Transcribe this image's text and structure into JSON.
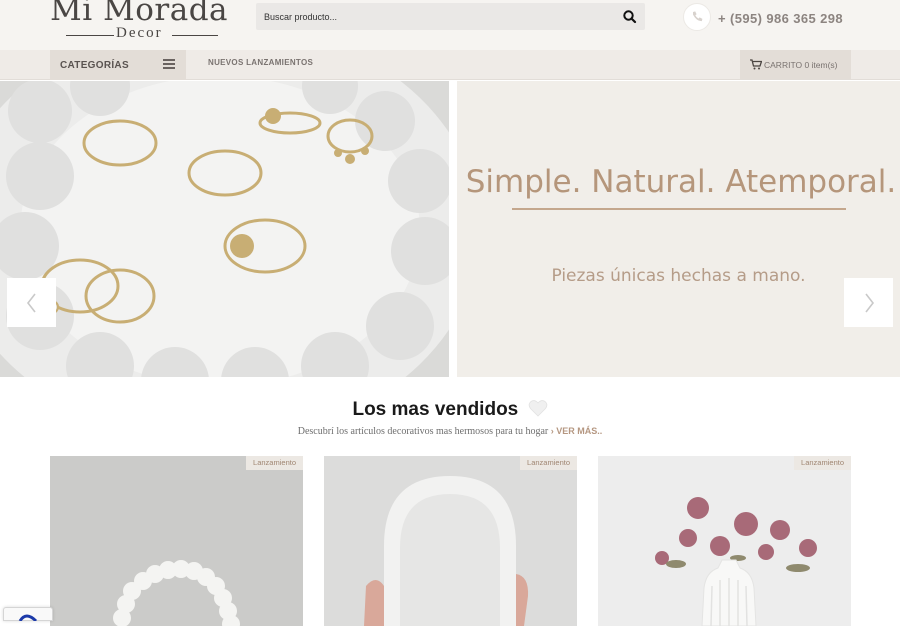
{
  "header": {
    "logo_main": "Mi Morada",
    "logo_sub": "Decor",
    "search_placeholder": "Buscar producto...",
    "search_icon": "search-icon",
    "phone_icon": "phone-icon",
    "phone_number": "+ (595) 986 365 298"
  },
  "nav": {
    "categories_label": "CATEGORÍAS",
    "categories_icon": "list-icon",
    "links": [
      {
        "label": "NUEVOS LANZAMIENTOS"
      }
    ],
    "cart_icon": "cart-icon",
    "cart_label": "CARRITO 0 item(s)"
  },
  "hero": {
    "tagline": "Simple. Natural. Atemporal.",
    "subtitle": "Piezas únicas hechas a mano.",
    "prev_icon": "chevron-left-icon",
    "next_icon": "chevron-right-icon"
  },
  "best_sellers": {
    "title": "Los mas vendidos",
    "heart_icon": "heart-icon",
    "subtitle": "Descubrí los artículos decorativos mas hermosos para tu hogar",
    "more_link": "› VER MÁS..",
    "products": [
      {
        "badge": "Lanzamiento"
      },
      {
        "badge": "Lanzamiento"
      },
      {
        "badge": "Lanzamiento"
      }
    ]
  },
  "colors": {
    "accent": "#b5967b",
    "header_bg": "#f6f4f1",
    "nav_bg": "#efebe7"
  }
}
